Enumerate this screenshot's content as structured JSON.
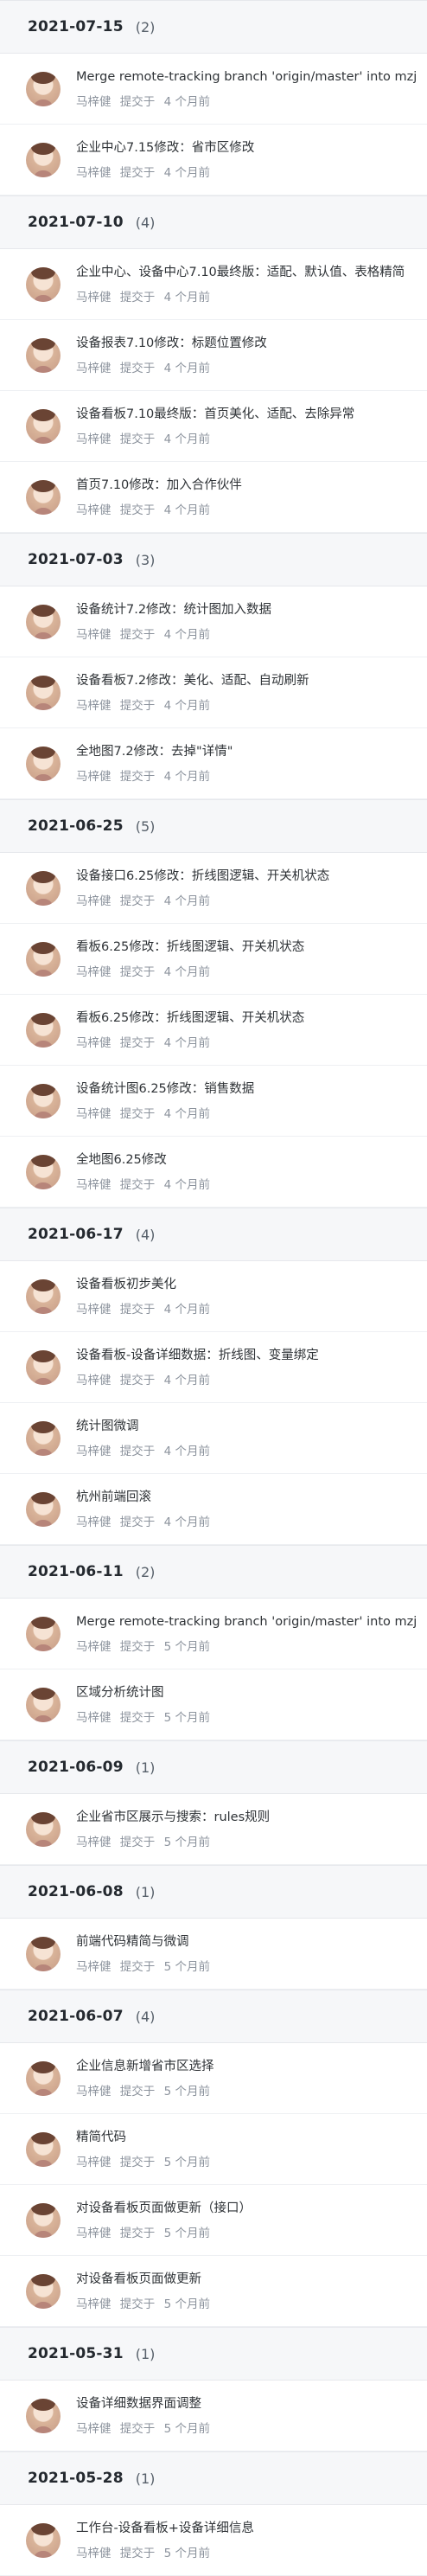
{
  "groups": [
    {
      "date": "2021-07-15",
      "count": "(2)",
      "commits": [
        {
          "message": "Merge remote-tracking branch 'origin/master' into mzj",
          "author": "马梓健",
          "action": "提交于",
          "time": "4 个月前"
        },
        {
          "message": "企业中心7.15修改：省市区修改",
          "author": "马梓健",
          "action": "提交于",
          "time": "4 个月前"
        }
      ]
    },
    {
      "date": "2021-07-10",
      "count": "(4)",
      "commits": [
        {
          "message": "企业中心、设备中心7.10最终版：适配、默认值、表格精简",
          "author": "马梓健",
          "action": "提交于",
          "time": "4 个月前"
        },
        {
          "message": "设备报表7.10修改：标题位置修改",
          "author": "马梓健",
          "action": "提交于",
          "time": "4 个月前"
        },
        {
          "message": "设备看板7.10最终版：首页美化、适配、去除异常",
          "author": "马梓健",
          "action": "提交于",
          "time": "4 个月前"
        },
        {
          "message": "首页7.10修改：加入合作伙伴",
          "author": "马梓健",
          "action": "提交于",
          "time": "4 个月前"
        }
      ]
    },
    {
      "date": "2021-07-03",
      "count": "(3)",
      "commits": [
        {
          "message": "设备统计7.2修改：统计图加入数据",
          "author": "马梓健",
          "action": "提交于",
          "time": "4 个月前"
        },
        {
          "message": "设备看板7.2修改：美化、适配、自动刷新",
          "author": "马梓健",
          "action": "提交于",
          "time": "4 个月前"
        },
        {
          "message": "全地图7.2修改：去掉\"详情\"",
          "author": "马梓健",
          "action": "提交于",
          "time": "4 个月前"
        }
      ]
    },
    {
      "date": "2021-06-25",
      "count": "(5)",
      "commits": [
        {
          "message": "设备接口6.25修改：折线图逻辑、开关机状态",
          "author": "马梓健",
          "action": "提交于",
          "time": "4 个月前"
        },
        {
          "message": "看板6.25修改：折线图逻辑、开关机状态",
          "author": "马梓健",
          "action": "提交于",
          "time": "4 个月前"
        },
        {
          "message": "看板6.25修改：折线图逻辑、开关机状态",
          "author": "马梓健",
          "action": "提交于",
          "time": "4 个月前"
        },
        {
          "message": "设备统计图6.25修改：销售数据",
          "author": "马梓健",
          "action": "提交于",
          "time": "4 个月前"
        },
        {
          "message": "全地图6.25修改",
          "author": "马梓健",
          "action": "提交于",
          "time": "4 个月前"
        }
      ]
    },
    {
      "date": "2021-06-17",
      "count": "(4)",
      "commits": [
        {
          "message": "设备看板初步美化",
          "author": "马梓健",
          "action": "提交于",
          "time": "4 个月前"
        },
        {
          "message": "设备看板-设备详细数据：折线图、变量绑定",
          "author": "马梓健",
          "action": "提交于",
          "time": "4 个月前"
        },
        {
          "message": "统计图微调",
          "author": "马梓健",
          "action": "提交于",
          "time": "4 个月前"
        },
        {
          "message": "杭州前端回滚",
          "author": "马梓健",
          "action": "提交于",
          "time": "4 个月前"
        }
      ]
    },
    {
      "date": "2021-06-11",
      "count": "(2)",
      "commits": [
        {
          "message": "Merge remote-tracking branch 'origin/master' into mzj",
          "author": "马梓健",
          "action": "提交于",
          "time": "5 个月前"
        },
        {
          "message": "区域分析统计图",
          "author": "马梓健",
          "action": "提交于",
          "time": "5 个月前"
        }
      ]
    },
    {
      "date": "2021-06-09",
      "count": "(1)",
      "commits": [
        {
          "message": "企业省市区展示与搜索：rules规则",
          "author": "马梓健",
          "action": "提交于",
          "time": "5 个月前"
        }
      ]
    },
    {
      "date": "2021-06-08",
      "count": "(1)",
      "commits": [
        {
          "message": "前端代码精简与微调",
          "author": "马梓健",
          "action": "提交于",
          "time": "5 个月前"
        }
      ]
    },
    {
      "date": "2021-06-07",
      "count": "(4)",
      "commits": [
        {
          "message": "企业信息新增省市区选择",
          "author": "马梓健",
          "action": "提交于",
          "time": "5 个月前"
        },
        {
          "message": "精简代码",
          "author": "马梓健",
          "action": "提交于",
          "time": "5 个月前"
        },
        {
          "message": "对设备看板页面做更新（接口）",
          "author": "马梓健",
          "action": "提交于",
          "time": "5 个月前"
        },
        {
          "message": "对设备看板页面做更新",
          "author": "马梓健",
          "action": "提交于",
          "time": "5 个月前"
        }
      ]
    },
    {
      "date": "2021-05-31",
      "count": "(1)",
      "commits": [
        {
          "message": "设备详细数据界面调整",
          "author": "马梓健",
          "action": "提交于",
          "time": "5 个月前"
        }
      ]
    },
    {
      "date": "2021-05-28",
      "count": "(1)",
      "commits": [
        {
          "message": "工作台-设备看板+设备详细信息",
          "author": "马梓健",
          "action": "提交于",
          "time": "5 个月前"
        }
      ]
    }
  ]
}
